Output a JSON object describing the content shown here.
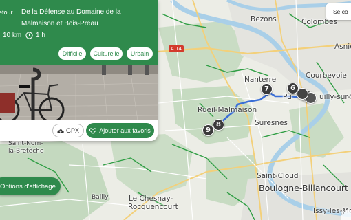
{
  "map": {
    "places": [
      {
        "id": "bezons",
        "label": "Bezons"
      },
      {
        "id": "colombes",
        "label": "Colombes"
      },
      {
        "id": "asnieres",
        "label": "Asniè"
      },
      {
        "id": "courbevoie",
        "label": "Courbevoie"
      },
      {
        "id": "nanterre",
        "label": "Nanterre"
      },
      {
        "id": "puteaux",
        "label": "Pu"
      },
      {
        "id": "neuilly",
        "label": "uilly-sur-Se"
      },
      {
        "id": "rueil",
        "label": "Rueil-Malmaison"
      },
      {
        "id": "suresnes",
        "label": "Suresnes"
      },
      {
        "id": "saint-nom",
        "label": "Saint-Nom-"
      },
      {
        "id": "la-breteche",
        "label": "la-Bretêche"
      },
      {
        "id": "saint-cloud",
        "label": "Saint-Cloud"
      },
      {
        "id": "boulogne",
        "label": "Boulogne-Billancourt"
      },
      {
        "id": "bailly",
        "label": "Bailly"
      },
      {
        "id": "chesnay",
        "label": "Le Chesnay-"
      },
      {
        "id": "rocquencourt",
        "label": "Rocquencourt"
      },
      {
        "id": "issy",
        "label": "Issy-les-Mo"
      }
    ],
    "road_shield": "A 14",
    "stops": [
      "6",
      "7",
      "8",
      "9"
    ],
    "route_color": "#3b6fd6",
    "attribution": "(?"
  },
  "card": {
    "tag": "etour",
    "title": "De la Défense au Domaine de la Malmaison et Bois-Préau",
    "distance": "10 km",
    "duration": "1 h",
    "chips": [
      "Difficile",
      "Culturelle",
      "Urbain"
    ],
    "gpx_label": "GPX",
    "favorite_label": "Ajouter aux favoris",
    "colors": {
      "brand": "#2f8a4c"
    }
  },
  "options_button": "Options d'affichage",
  "search_label": "Se co"
}
